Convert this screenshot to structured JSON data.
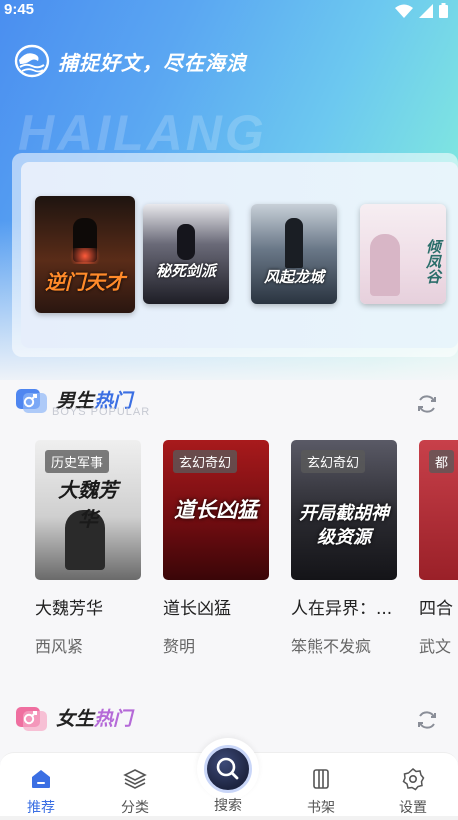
{
  "status_bar": {
    "time": "9:45"
  },
  "brand": {
    "slogan": "捕捉好文，尽在海浪",
    "watermark": "HAILANG"
  },
  "banner": {
    "books": [
      {
        "cover_title": "逆门天才",
        "cover_color": "#3a2418"
      },
      {
        "cover_title": "秘死剑派",
        "cover_color": "#2a2a34"
      },
      {
        "cover_title": "风起龙城",
        "cover_color": "#4a5664"
      },
      {
        "cover_title": "倾凤谷",
        "cover_color": "#f2e4ea"
      }
    ]
  },
  "male_section": {
    "title_part1": "男生",
    "title_part2": "热门",
    "subtitle": "BOYS POPULAR",
    "books": [
      {
        "tag": "历史军事",
        "title": "大魏芳华",
        "author": "西风紧",
        "cover_text": "大魏芳华",
        "cover_color": "#d8d6d2"
      },
      {
        "tag": "玄幻奇幻",
        "title": "道长凶猛",
        "author": "赘明",
        "cover_text": "道长凶猛",
        "cover_color": "#7a1214"
      },
      {
        "tag": "玄幻奇幻",
        "title": "人在异界：...",
        "author": "笨熊不发疯",
        "cover_text": "开局截胡神级资源",
        "cover_color": "#2a2a30"
      },
      {
        "tag": "都",
        "title": "四合",
        "author": "武文",
        "cover_text": "",
        "cover_color": "#b8323a"
      }
    ]
  },
  "female_section": {
    "title_part1": "女生",
    "title_part2": "热门"
  },
  "tabbar": {
    "items": [
      {
        "label": "推荐",
        "active": true
      },
      {
        "label": "分类",
        "active": false
      },
      {
        "label": "搜索",
        "active": false
      },
      {
        "label": "书架",
        "active": false
      },
      {
        "label": "设置",
        "active": false
      }
    ]
  },
  "colors": {
    "accent": "#3b6fe3",
    "male_icon": "#4f86f0",
    "female_icon": "#ef6fa0"
  }
}
